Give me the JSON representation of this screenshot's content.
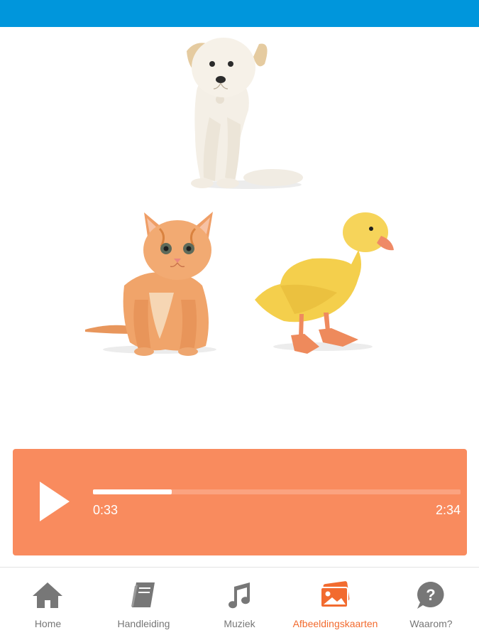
{
  "player": {
    "current_time": "0:33",
    "total_time": "2:34",
    "progress_fraction": 0.214
  },
  "tabs": [
    {
      "label": "Home",
      "icon": "home-icon"
    },
    {
      "label": "Handleiding",
      "icon": "book-icon"
    },
    {
      "label": "Muziek",
      "icon": "music-note-icon"
    },
    {
      "label": "Afbeeldingskaarten",
      "icon": "image-cards-icon",
      "active": true
    },
    {
      "label": "Waarom?",
      "icon": "question-bubble-icon"
    }
  ],
  "colors": {
    "top_bar": "#0096dc",
    "player_bg": "#f98b5e",
    "active_tab": "#f26b2f",
    "inactive_tab": "#777777"
  }
}
